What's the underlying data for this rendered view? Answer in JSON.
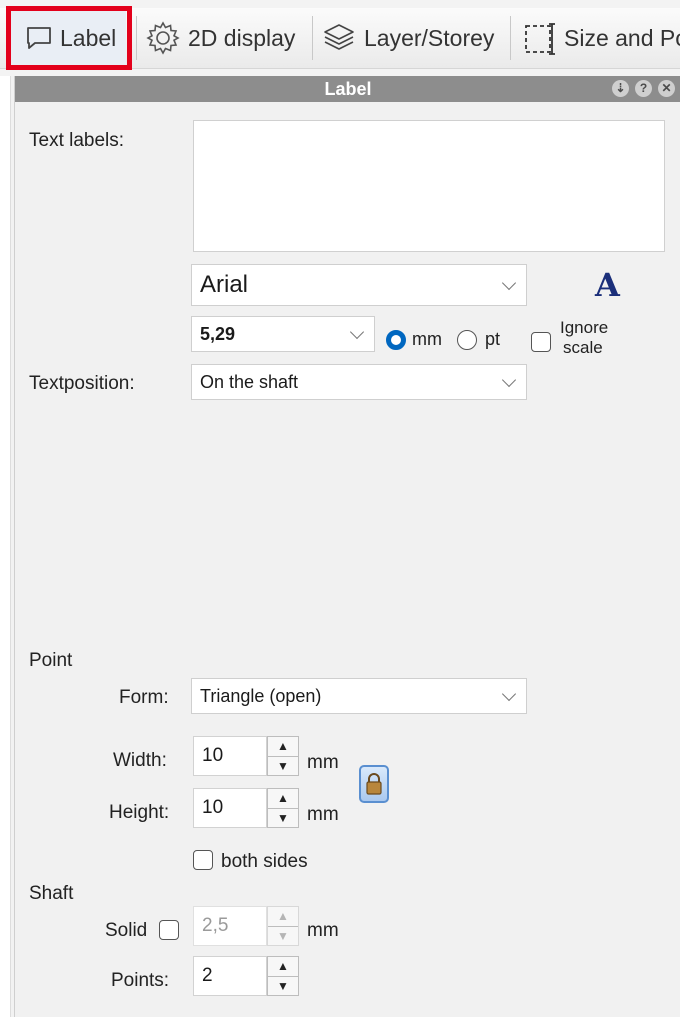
{
  "tabs": {
    "label": "Label",
    "display2d": "2D display",
    "layer": "Layer/Storey",
    "size": "Size and Pos"
  },
  "panel": {
    "title": "Label",
    "header_buttons": [
      "minimize-icon",
      "help-icon",
      "close-icon"
    ]
  },
  "text_labels": {
    "label": "Text labels:",
    "value": ""
  },
  "font": {
    "family": "Arial",
    "size": "5,29",
    "unit_mm": "mm",
    "unit_pt": "pt",
    "selected_unit": "mm",
    "ignore_scale_line1": "Ignore",
    "ignore_scale_line2": "scale",
    "ignore_scale_checked": false,
    "font_icon": "A"
  },
  "textposition": {
    "label": "Textposition:",
    "value": "On the shaft"
  },
  "point": {
    "section": "Point",
    "form_label": "Form:",
    "form_value": "Triangle (open)",
    "width_label": "Width:",
    "width_value": "10",
    "height_label": "Height:",
    "height_value": "10",
    "unit": "mm",
    "both_sides_label": "both sides",
    "both_sides_checked": false
  },
  "shaft": {
    "section": "Shaft",
    "solid_label": "Solid",
    "solid_checked": false,
    "thickness_value": "2,5",
    "unit": "mm",
    "points_label": "Points:",
    "points_value": "2"
  },
  "colors": {
    "highlight": "#e3001b",
    "header": "#8d8d8d",
    "radio_accent": "#0067c0",
    "font_icon": "#1b2f7a"
  }
}
